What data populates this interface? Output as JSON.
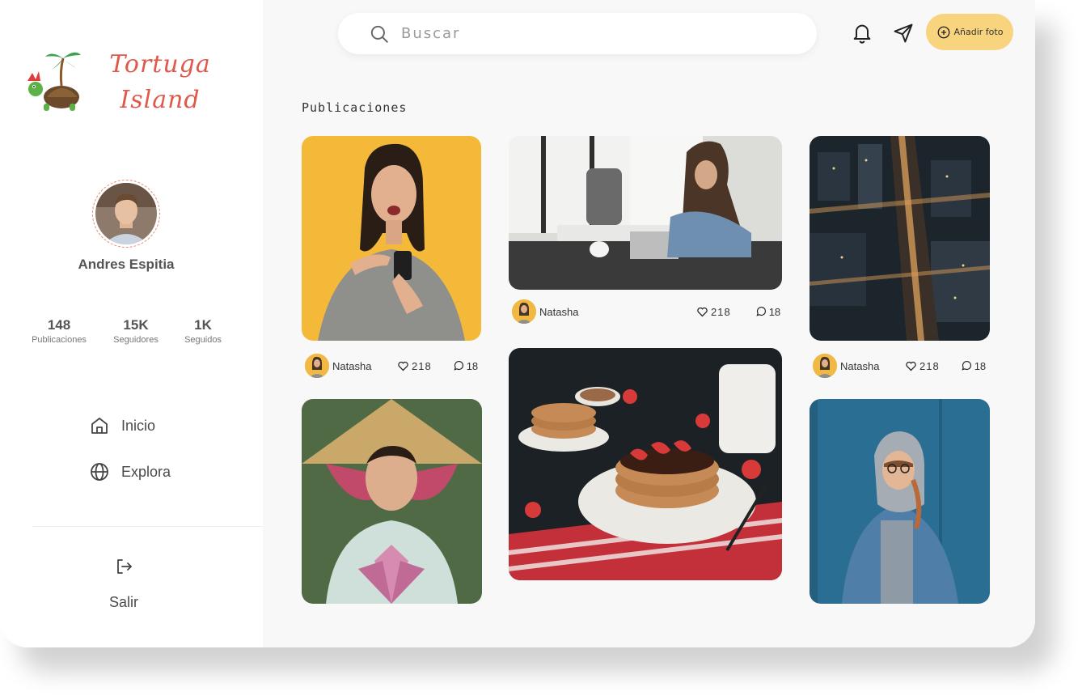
{
  "brand": {
    "name_line1": "Tortuga",
    "name_line2": "Island",
    "primary_color": "#e0584a",
    "accent_color": "#f8d47e"
  },
  "profile": {
    "name": "Andres Espitia",
    "stats": [
      {
        "value": "148",
        "label": "Publicaciones"
      },
      {
        "value": "15K",
        "label": "Seguidores"
      },
      {
        "value": "1K",
        "label": "Seguidos"
      }
    ]
  },
  "nav": {
    "items": [
      {
        "label": "Inicio",
        "icon": "home-icon"
      },
      {
        "label": "Explora",
        "icon": "globe-icon"
      }
    ],
    "logout_label": "Salir"
  },
  "topbar": {
    "search_placeholder": "Buscar",
    "add_button_label": "Añadir foto"
  },
  "feed": {
    "title": "Publicaciones",
    "posts": [
      {
        "subject": "woman-with-phone",
        "author": "Natasha",
        "likes": "218",
        "comments": "18"
      },
      {
        "subject": "woman-at-cafe-laptop",
        "author": "Natasha",
        "likes": "218",
        "comments": "18"
      },
      {
        "subject": "city-aerial-night",
        "author": "Natasha",
        "likes": "218",
        "comments": "18"
      },
      {
        "subject": "woman-with-lotus"
      },
      {
        "subject": "pancakes-strawberries"
      },
      {
        "subject": "woman-in-denim-jacket"
      }
    ]
  }
}
